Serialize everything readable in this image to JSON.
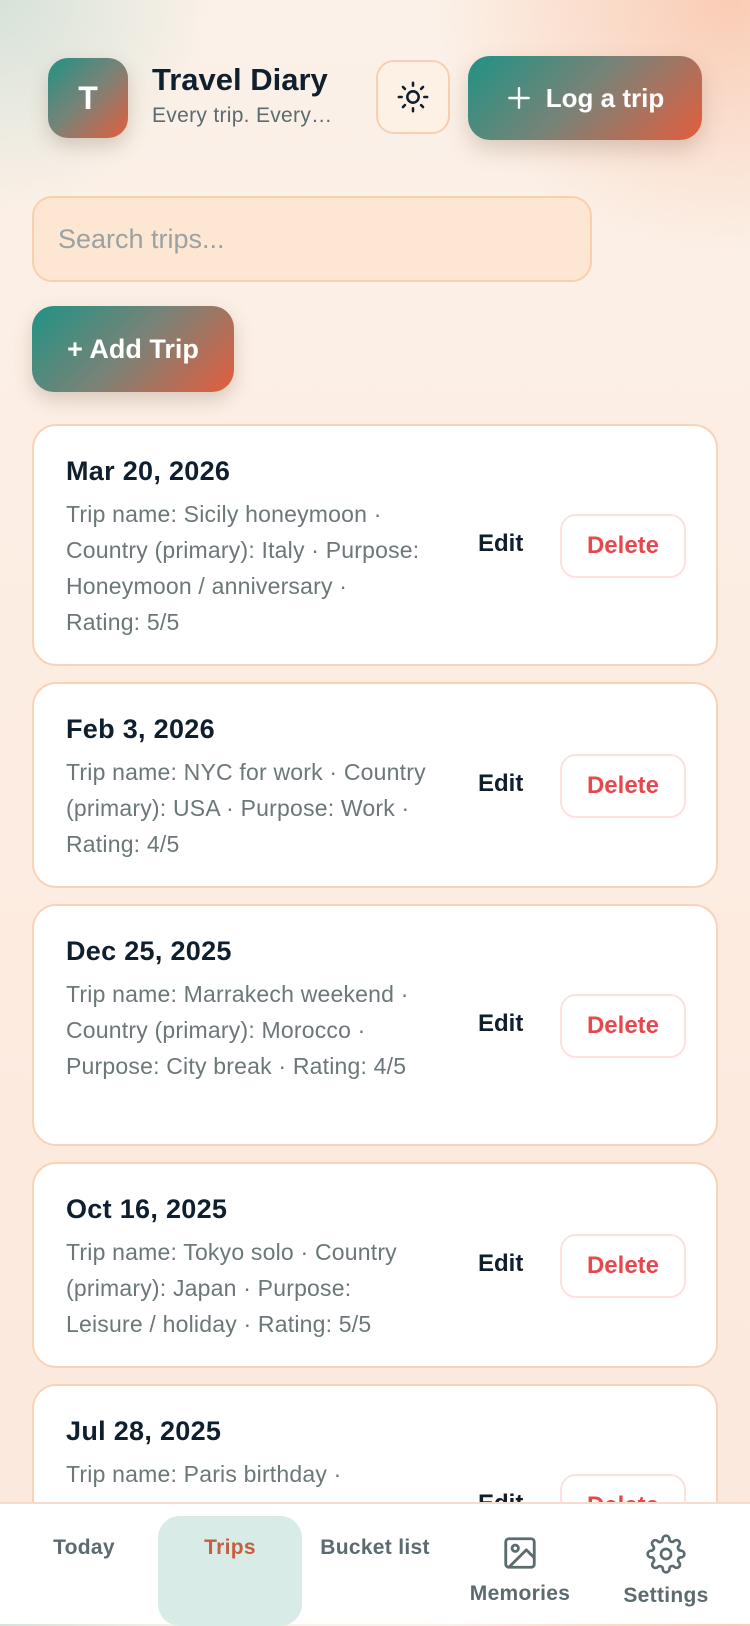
{
  "header": {
    "avatar_letter": "T",
    "title": "Travel Diary",
    "subtitle": "Every trip. Every…",
    "log_button": "Log a trip"
  },
  "search": {
    "placeholder": "Search trips..."
  },
  "add_button": "+ Add Trip",
  "trips": [
    {
      "date": "Mar 20, 2026",
      "desc": "Trip name: Sicily honeymoon · Country (primary): Italy · Purpose: Honeymoon / anniversary · Rating: 5/5",
      "edit": "Edit",
      "delete": "Delete"
    },
    {
      "date": "Feb 3, 2026",
      "desc": "Trip name: NYC for work · Country (primary): USA · Purpose: Work · Rating: 4/5",
      "edit": "Edit",
      "delete": "Delete"
    },
    {
      "date": "Dec 25, 2025",
      "desc": "Trip name: Marrakech weekend · Country (primary): Morocco · Purpose: City break · Rating: 4/5",
      "edit": "Edit",
      "delete": "Delete"
    },
    {
      "date": "Oct 16, 2025",
      "desc": "Trip name: Tokyo solo · Country (primary): Japan · Purpose: Leisure / holiday · Rating: 5/5",
      "edit": "Edit",
      "delete": "Delete"
    },
    {
      "date": "Jul 28, 2025",
      "desc": "Trip name: Paris birthday ·",
      "edit": "Edit",
      "delete": "Delete"
    }
  ],
  "nav": {
    "today": "Today",
    "trips": "Trips",
    "bucket": "Bucket list",
    "memories": "Memories",
    "settings": "Settings"
  },
  "colors": {
    "gradient_start": "#1f9385",
    "gradient_end": "#e45d3d",
    "delete": "#e5484d",
    "active_tab": "#c4603f"
  }
}
